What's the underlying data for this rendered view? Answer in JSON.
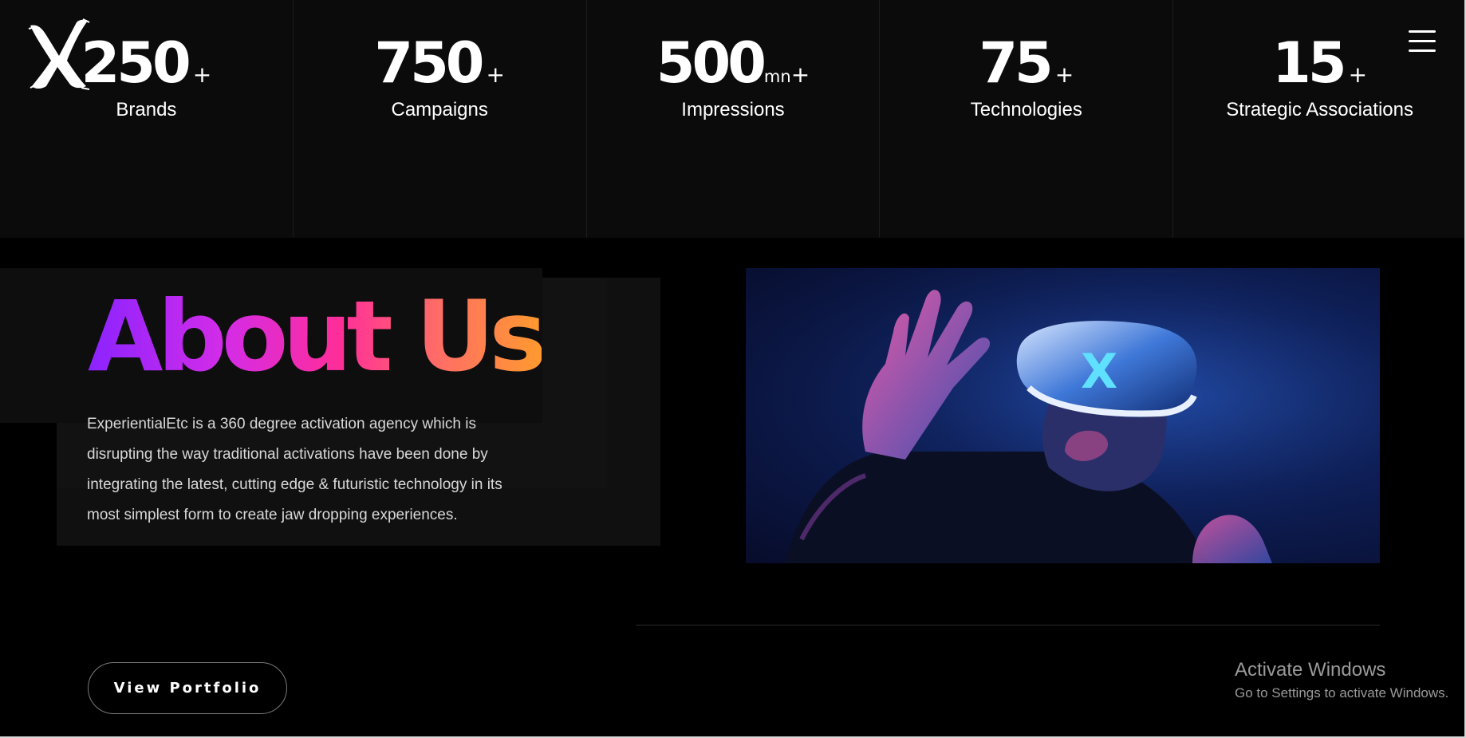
{
  "stats": [
    {
      "value": "250",
      "unit": "",
      "plus": "+",
      "label": "Brands"
    },
    {
      "value": "750",
      "unit": "",
      "plus": "+",
      "label": "Campaigns"
    },
    {
      "value": "500",
      "unit": "mn",
      "plus": "+",
      "label": "Impressions"
    },
    {
      "value": "75",
      "unit": "",
      "plus": "+",
      "label": "Technologies"
    },
    {
      "value": "15",
      "unit": "",
      "plus": "+",
      "label": "Strategic Associations"
    }
  ],
  "logo": {
    "icon": "x-brush-logo-icon",
    "color": "#ffffff"
  },
  "menu": {
    "icon": "hamburger-menu-icon"
  },
  "about": {
    "title": "About Us",
    "gradient": [
      "#8b23ff",
      "#ff2d9a",
      "#ff9a2e"
    ],
    "description": "ExperientialEtc is a 360 degree activation agency which is disrupting the way traditional activations have been done by integrating the latest, cutting edge & futuristic technology in its most simplest form to create jaw dropping experiences."
  },
  "image": {
    "subject": "man-wearing-vr-headset",
    "headset_logo": "X"
  },
  "buttons": {
    "portfolio": "View Portfolio"
  },
  "watermark": {
    "title": "Activate Windows",
    "subtitle": "Go to Settings to activate Windows."
  },
  "colors": {
    "background": "#000000",
    "stats_band": "#0b0b0b",
    "text": "#ffffff",
    "body_text": "#d8d8d8"
  }
}
